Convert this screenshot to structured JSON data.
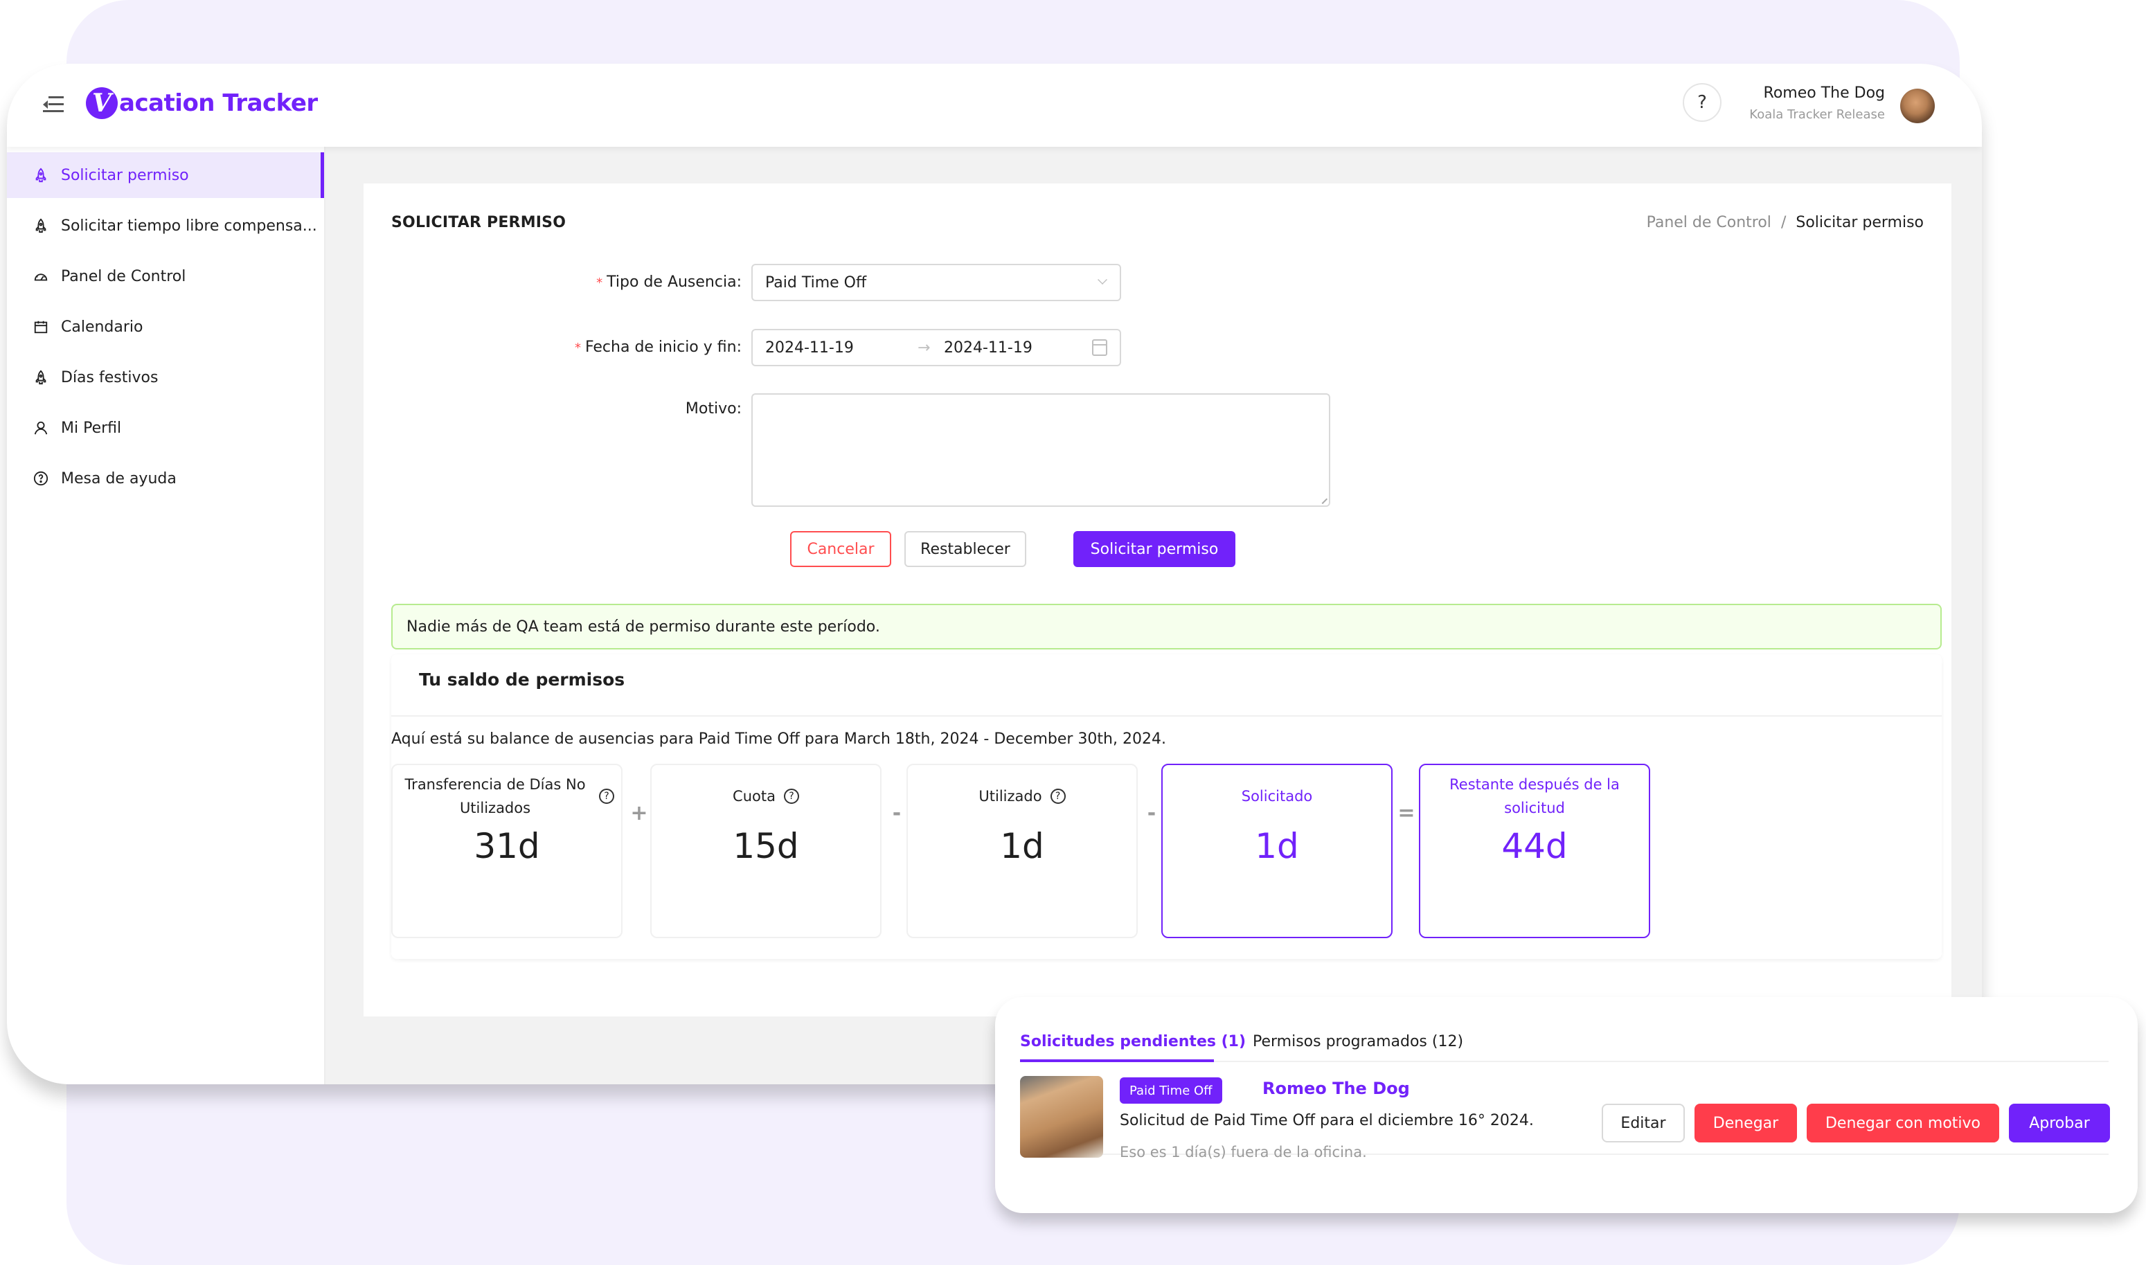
{
  "app": {
    "name": "Vacation Tracker",
    "logo_letter": "V",
    "logo_text": "acation Tracker"
  },
  "header": {
    "help_label": "?",
    "user_name": "Romeo The Dog",
    "user_org": "Koala Tracker Release"
  },
  "sidebar": {
    "items": [
      {
        "label": "Solicitar permiso",
        "icon": "rocket-icon",
        "active": true
      },
      {
        "label": "Solicitar tiempo libre compensa...",
        "icon": "rocket-icon",
        "active": false
      },
      {
        "label": "Panel de Control",
        "icon": "dashboard-icon",
        "active": false
      },
      {
        "label": "Calendario",
        "icon": "calendar-icon",
        "active": false
      },
      {
        "label": "Días festivos",
        "icon": "rocket-icon",
        "active": false
      },
      {
        "label": "Mi Perfil",
        "icon": "user-icon",
        "active": false
      },
      {
        "label": "Mesa de ayuda",
        "icon": "question-circle-icon",
        "active": false
      }
    ]
  },
  "page": {
    "title": "SOLICITAR PERMISO",
    "breadcrumb": {
      "parent": "Panel de Control",
      "separator": "/",
      "current": "Solicitar permiso"
    }
  },
  "form": {
    "required_mark": "*",
    "leave_type": {
      "label": "Tipo de Ausencia",
      "value": "Paid Time Off"
    },
    "date_range": {
      "label": "Fecha de inicio y fin",
      "start": "2024-11-19",
      "end": "2024-11-19",
      "separator": "→"
    },
    "reason": {
      "label": "Motivo",
      "value": ""
    },
    "colon": ":",
    "buttons": {
      "cancel": "Cancelar",
      "reset": "Restablecer",
      "submit": "Solicitar permiso"
    }
  },
  "alert": {
    "text": "Nadie más de QA team está de permiso durante este período.",
    "type": "success"
  },
  "balance": {
    "title": "Tu saldo de permisos",
    "description": "Aquí está su balance de ausencias para Paid Time Off para March 18th, 2024 - December 30th, 2024.",
    "stats": [
      {
        "label": "Transferencia de Días No Utilizados",
        "value": "31d",
        "help": true,
        "highlight": false
      },
      {
        "label": "Cuota",
        "value": "15d",
        "help": true,
        "highlight": false
      },
      {
        "label": "Utilizado",
        "value": "1d",
        "help": true,
        "highlight": false
      },
      {
        "label": "Solicitado",
        "value": "1d",
        "help": false,
        "highlight": true
      },
      {
        "label": "Restante después de la solicitud",
        "value": "44d",
        "help": false,
        "highlight": true
      }
    ],
    "operators": [
      "+",
      "-",
      "-",
      "="
    ]
  },
  "requests_panel": {
    "tabs": [
      {
        "label": "Solicitudes pendientes (1)",
        "active": true
      },
      {
        "label": "Permisos programados (12)",
        "active": false
      }
    ],
    "items": [
      {
        "leave_type": "Paid Time Off",
        "user": "Romeo The Dog",
        "description": "Solicitud de Paid Time Off para el diciembre 16° 2024.",
        "duration": "Eso es 1 día(s) fuera de la oficina.",
        "actions": {
          "edit": "Editar",
          "deny": "Denegar",
          "deny_reason": "Denegar con motivo",
          "approve": "Aprobar"
        }
      }
    ]
  },
  "colors": {
    "brand": "#7122fa",
    "danger": "#ff3d4b",
    "success_bg": "#f6ffed",
    "success_border": "#b7eb8f",
    "background_blob": "#f3f0fd"
  }
}
